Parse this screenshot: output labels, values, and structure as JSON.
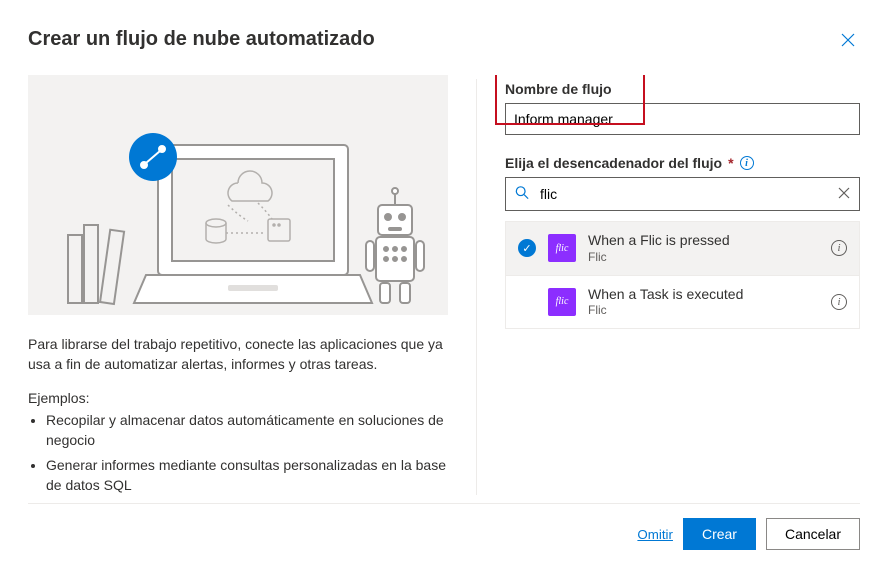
{
  "dialog": {
    "title": "Crear un flujo de nube automatizado",
    "description": "Para librarse del trabajo repetitivo, conecte las aplicaciones que ya usa a fin de automatizar alertas, informes y otras tareas.",
    "examples_label": "Ejemplos:",
    "examples": [
      "Recopilar y almacenar datos automáticamente en soluciones de negocio",
      "Generar informes mediante consultas personalizadas en la base de datos SQL"
    ]
  },
  "form": {
    "name_label": "Nombre de flujo",
    "name_value": "Inform manager",
    "trigger_label": "Elija el desencadenador del flujo",
    "search_value": "flic"
  },
  "triggers": [
    {
      "title": "When a Flic is pressed",
      "connector": "Flic",
      "selected": true,
      "icon_text": "flic"
    },
    {
      "title": "When a Task is executed",
      "connector": "Flic",
      "selected": false,
      "icon_text": "flic"
    }
  ],
  "footer": {
    "skip": "Omitir",
    "create": "Crear",
    "cancel": "Cancelar"
  }
}
